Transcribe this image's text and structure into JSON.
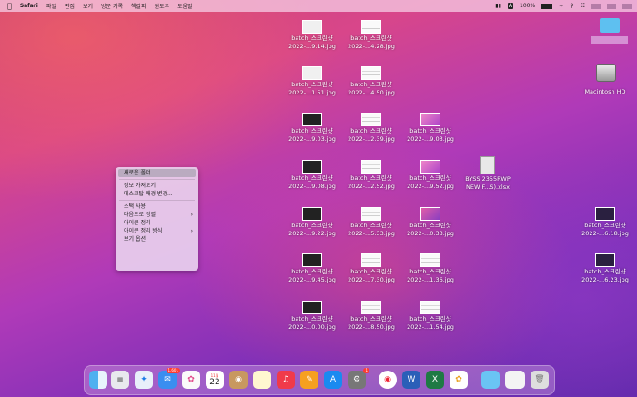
{
  "menubar": {
    "apple": "",
    "app": "Safari",
    "items": [
      "파일",
      "편집",
      "보기",
      "방문 기록",
      "책갈피",
      "윈도우",
      "도움말"
    ],
    "battery": "100%"
  },
  "files": [
    {
      "line1": "batch_스크린샷",
      "line2": "2022-...9.14.jpg"
    },
    {
      "line1": "batch_스크린샷",
      "line2": "2022-...4.28.jpg"
    },
    {
      "line1": "batch_스크린샷",
      "line2": "2022-...1.51.jpg"
    },
    {
      "line1": "batch_스크린샷",
      "line2": "2022-...4.50.jpg"
    },
    {
      "line1": "batch_스크린샷",
      "line2": "2022-...9.03.jpg"
    },
    {
      "line1": "batch_스크린샷",
      "line2": "2022-...2.39.jpg"
    },
    {
      "line1": "batch_스크린샷",
      "line2": "2022-...9.03.jpg"
    },
    {
      "line1": "batch_스크린샷",
      "line2": "2022-...9.08.jpg"
    },
    {
      "line1": "batch_스크린샷",
      "line2": "2022-...2.52.jpg"
    },
    {
      "line1": "batch_스크린샷",
      "line2": "2022-...9.52.jpg"
    },
    {
      "line1": "BYSS 2355RWP",
      "line2": "NEW F...S).xlsx"
    },
    {
      "line1": "batch_스크린샷",
      "line2": "2022-...9.22.jpg"
    },
    {
      "line1": "batch_스크린샷",
      "line2": "2022-...5.33.jpg"
    },
    {
      "line1": "batch_스크린샷",
      "line2": "2022-...0.33.jpg"
    },
    {
      "line1": "batch_스크린샷",
      "line2": "2022-...9.45.jpg"
    },
    {
      "line1": "batch_스크린샷",
      "line2": "2022-...7.30.jpg"
    },
    {
      "line1": "batch_스크린샷",
      "line2": "2022-...1.36.jpg"
    },
    {
      "line1": "batch_스크린샷",
      "line2": "2022-...0.00.jpg"
    },
    {
      "line1": "batch_스크린샷",
      "line2": "2022-...8.50.jpg"
    },
    {
      "line1": "batch_스크린샷",
      "line2": "2022-...1.54.jpg"
    },
    {
      "line1": "batch_스크린샷",
      "line2": "2022-...6.18.jpg"
    },
    {
      "line1": "batch_스크린샷",
      "line2": "2022-...6.23.jpg"
    }
  ],
  "drive": {
    "label": "Macintosh HD"
  },
  "context_menu": {
    "new_folder": "새로운 폴더",
    "get_info": "정보 가져오기",
    "change_bg": "데스크탑 배경 변경...",
    "use_stacks": "스택 사용",
    "sort_by": "다음으로 정렬",
    "clean_up": "아이콘 정리",
    "clean_up_by": "아이콘 정리 방식",
    "view_options": "보기 옵션"
  },
  "dock": {
    "mail_badge": "1,601",
    "calendar_month": "11월",
    "calendar_day": "22",
    "settings_badge": "1"
  }
}
